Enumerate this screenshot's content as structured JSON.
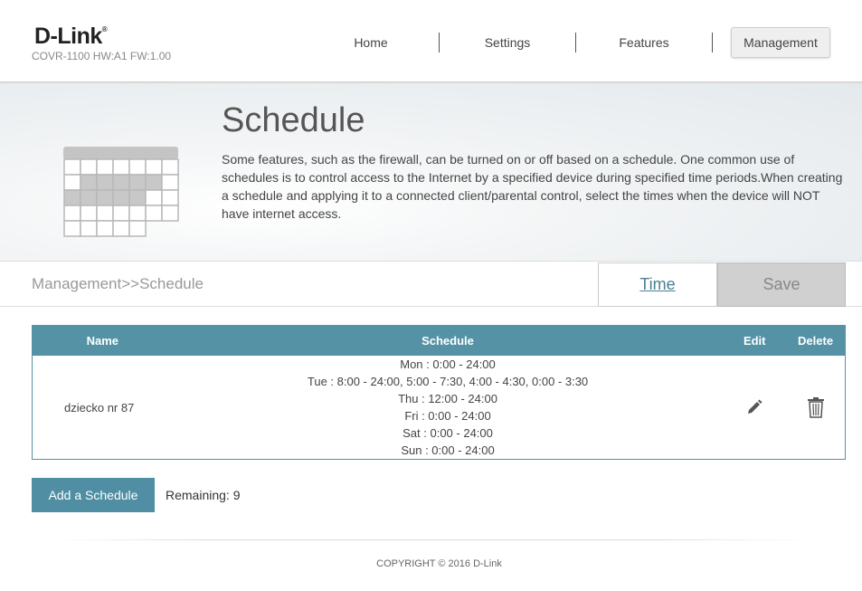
{
  "header": {
    "logo_text": "D-Link",
    "logo_mark": "®",
    "model_info": "COVR-1100 HW:A1 FW:1.00",
    "nav": [
      {
        "label": "Home"
      },
      {
        "label": "Settings"
      },
      {
        "label": "Features"
      },
      {
        "label": "Management"
      }
    ],
    "active_nav": "Management"
  },
  "banner": {
    "title": "Schedule",
    "description": "Some features, such as the firewall, can be turned on or off based on a schedule. One common use of schedules is to control access to the Internet by a specified device during specified time periods.When creating a schedule and applying it to a connected client/parental control, select the times when the device will NOT have internet access.",
    "icon": "calendar-icon"
  },
  "toolbar": {
    "breadcrumb": "Management>>Schedule",
    "time_label": "Time",
    "save_label": "Save"
  },
  "table": {
    "headers": {
      "name": "Name",
      "schedule": "Schedule",
      "edit": "Edit",
      "delete": "Delete"
    },
    "rows": [
      {
        "name": "dziecko nr 87",
        "schedule_lines": [
          "Mon : 0:00 - 24:00",
          "Tue : 8:00 - 24:00, 5:00 - 7:30, 4:00 - 4:30, 0:00 - 3:30",
          "Thu : 12:00 - 24:00",
          "Fri : 0:00 - 24:00",
          "Sat : 0:00 - 24:00",
          "Sun : 0:00 - 24:00"
        ],
        "edit_icon": "pencil-icon",
        "delete_icon": "trash-icon"
      }
    ]
  },
  "actions": {
    "add_label": "Add a Schedule",
    "remaining": "Remaining: 9"
  },
  "footer": {
    "copyright": "COPYRIGHT © 2016 D-Link"
  },
  "colors": {
    "accent": "#5592a6",
    "button": "#4f8ea3",
    "save_disabled": "#d0d0d0"
  }
}
